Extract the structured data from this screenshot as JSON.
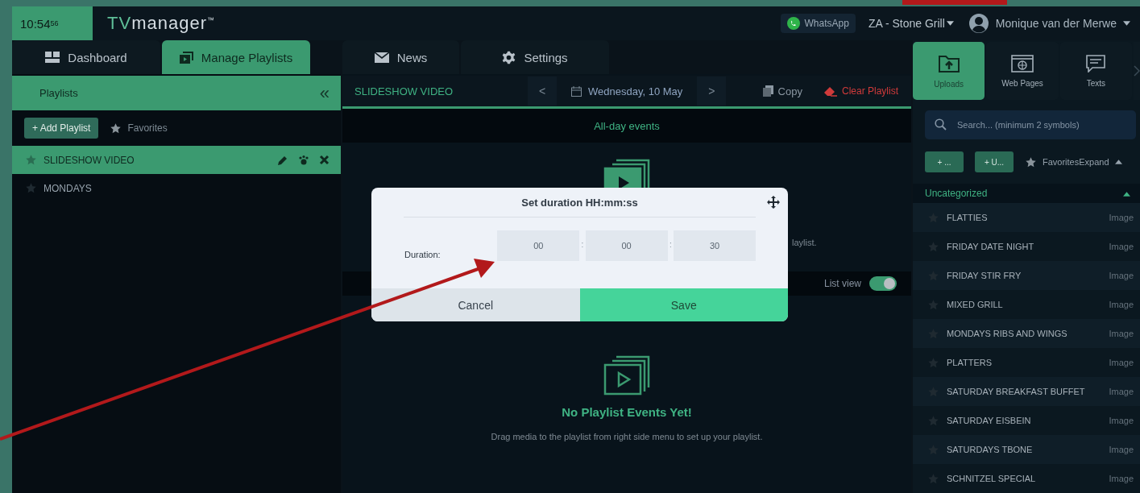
{
  "header": {
    "clock": {
      "time": "10:54",
      "seconds": "56"
    },
    "logo": {
      "prefix": "TV",
      "name": "manager",
      "mark": "™"
    },
    "whatsapp": "WhatsApp",
    "location": "ZA - Stone Grill",
    "user": "Monique van der Merwe"
  },
  "nav_tabs": [
    {
      "label": "Dashboard",
      "selected": false
    },
    {
      "label": "Manage Playlists",
      "selected": true
    },
    {
      "label": "News",
      "selected": false
    },
    {
      "label": "Settings",
      "selected": false
    }
  ],
  "playlists_panel": {
    "title": "Playlists",
    "collapse": "«",
    "add_button": "+ Add Playlist",
    "favorites": "Favorites",
    "items": [
      {
        "name": "SLIDESHOW VIDEO",
        "selected": true
      },
      {
        "name": "MONDAYS",
        "selected": false
      }
    ]
  },
  "schedule": {
    "title": "SLIDESHOW VIDEO",
    "prev": "<",
    "date": "Wednesday, 10 May",
    "next": ">",
    "copy": "Copy",
    "clear": "Clear Playlist",
    "all_day": "All-day events",
    "covered_text": "laylist.",
    "list_view": {
      "label": "List view",
      "on": true
    },
    "empty": {
      "title": "No Playlist Events Yet!",
      "description": "Drag media to the playlist from right side menu to set up your playlist."
    }
  },
  "dialog": {
    "title": "Set duration HH:mm:ss",
    "duration_label": "Duration:",
    "fields": [
      "00",
      "00",
      "30"
    ],
    "separator": ":",
    "buttons": [
      {
        "label": "Cancel",
        "kind": "secondary"
      },
      {
        "label": "Save",
        "kind": "primary"
      }
    ]
  },
  "media_panel": {
    "tabs": [
      {
        "label": "Uploads",
        "selected": true,
        "kind": "upload"
      },
      {
        "label": "Web Pages",
        "selected": false,
        "kind": "web"
      },
      {
        "label": "Texts",
        "selected": false,
        "kind": "text"
      }
    ],
    "search_placeholder": "Search... (minimum 2 symbols)",
    "buttons": [
      "+ ...",
      "+ U..."
    ],
    "favorites_expand": "FavoritesExpand",
    "category": {
      "name": "Uncategorized",
      "expanded": true
    },
    "items": [
      {
        "name": "FLATTIES",
        "type": "Image"
      },
      {
        "name": "FRIDAY DATE NIGHT",
        "type": "Image"
      },
      {
        "name": "FRIDAY STIR FRY",
        "type": "Image"
      },
      {
        "name": "MIXED GRILL",
        "type": "Image"
      },
      {
        "name": "MONDAYS RIBS AND WINGS",
        "type": "Image"
      },
      {
        "name": "PLATTERS",
        "type": "Image"
      },
      {
        "name": "SATURDAY BREAKFAST BUFFET",
        "type": "Image"
      },
      {
        "name": "SATURDAY EISBEIN",
        "type": "Image"
      },
      {
        "name": "SATURDAYS TBONE",
        "type": "Image"
      },
      {
        "name": "SCHNITZEL SPECIAL",
        "type": "Image"
      }
    ]
  }
}
